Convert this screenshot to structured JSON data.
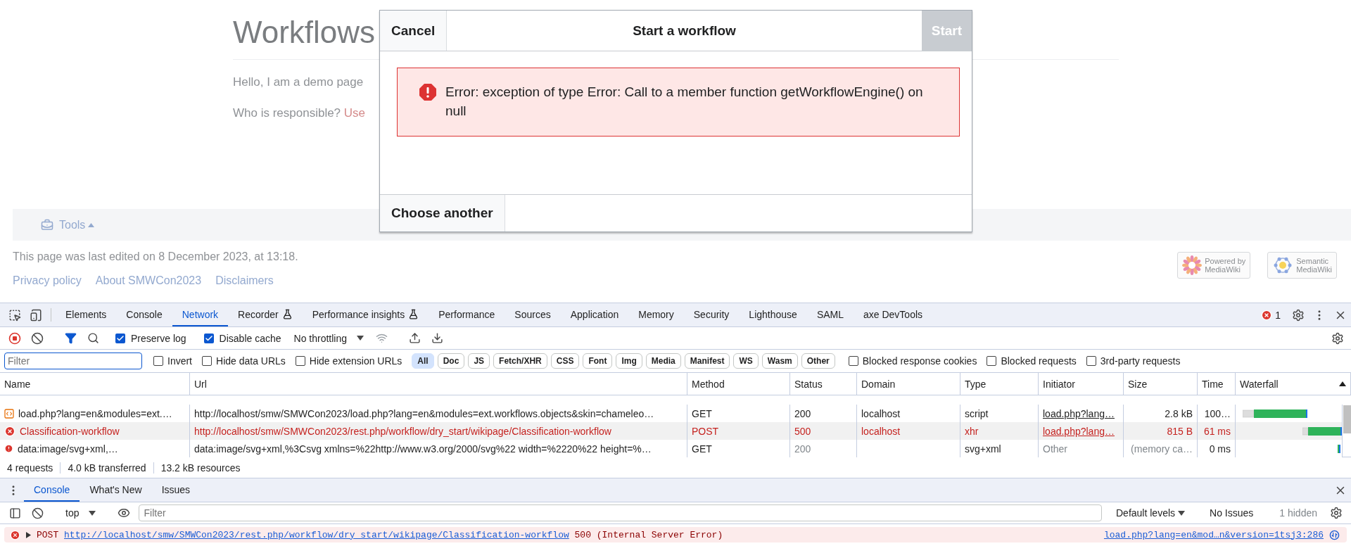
{
  "page": {
    "title": "Workflows",
    "intro": "Hello, I am a demo page",
    "responsible_label": "Who is responsible?",
    "responsible_link": "Use",
    "tools_label": "Tools",
    "last_edited": "This page was last edited on 8 December 2023, at 13:18.",
    "footer_links": [
      "Privacy policy",
      "About SMWCon2023",
      "Disclaimers"
    ],
    "badges": [
      {
        "line1": "Powered by",
        "line2": "MediaWiki",
        "kind": "flower"
      },
      {
        "line1": "Semantic",
        "line2": "MediaWiki",
        "kind": "network"
      }
    ]
  },
  "dialog": {
    "cancel": "Cancel",
    "title": "Start a workflow",
    "start": {
      "label": "Start",
      "disabled": true
    },
    "error": "Error: exception of type Error: Call to a member function getWorkflowEngine() on null",
    "choose": "Choose another"
  },
  "devtools": {
    "tabs": [
      {
        "label": "Elements",
        "selected": false,
        "experimental": false
      },
      {
        "label": "Console",
        "selected": false,
        "experimental": false
      },
      {
        "label": "Network",
        "selected": true,
        "experimental": false
      },
      {
        "label": "Recorder",
        "selected": false,
        "experimental": true
      },
      {
        "label": "Performance insights",
        "selected": false,
        "experimental": true
      },
      {
        "label": "Performance",
        "selected": false,
        "experimental": false
      },
      {
        "label": "Sources",
        "selected": false,
        "experimental": false
      },
      {
        "label": "Application",
        "selected": false,
        "experimental": false
      },
      {
        "label": "Memory",
        "selected": false,
        "experimental": false
      },
      {
        "label": "Security",
        "selected": false,
        "experimental": false
      },
      {
        "label": "Lighthouse",
        "selected": false,
        "experimental": false
      },
      {
        "label": "SAML",
        "selected": false,
        "experimental": false
      },
      {
        "label": "axe DevTools",
        "selected": false,
        "experimental": false
      }
    ],
    "error_count": "1",
    "toolbar": {
      "preserve_log": {
        "label": "Preserve log",
        "checked": true
      },
      "disable_cache": {
        "label": "Disable cache",
        "checked": true
      },
      "throttling": "No throttling"
    },
    "filter": {
      "placeholder": "Filter"
    },
    "filter_options": [
      {
        "label": "Invert",
        "checked": false
      },
      {
        "label": "Hide data URLs",
        "checked": false
      },
      {
        "label": "Hide extension URLs",
        "checked": false
      }
    ],
    "type_filters": [
      {
        "label": "All",
        "selected": true
      },
      {
        "label": "Doc",
        "selected": false
      },
      {
        "label": "JS",
        "selected": false
      },
      {
        "label": "Fetch/XHR",
        "selected": false
      },
      {
        "label": "CSS",
        "selected": false
      },
      {
        "label": "Font",
        "selected": false
      },
      {
        "label": "Img",
        "selected": false
      },
      {
        "label": "Media",
        "selected": false
      },
      {
        "label": "Manifest",
        "selected": false
      },
      {
        "label": "WS",
        "selected": false
      },
      {
        "label": "Wasm",
        "selected": false
      },
      {
        "label": "Other",
        "selected": false
      }
    ],
    "extra_filters": [
      {
        "label": "Blocked response cookies",
        "checked": false
      },
      {
        "label": "Blocked requests",
        "checked": false
      },
      {
        "label": "3rd-party requests",
        "checked": false
      }
    ],
    "table": {
      "columns": [
        {
          "label": "Name",
          "sorted": false
        },
        {
          "label": "Url",
          "sorted": false
        },
        {
          "label": "Method",
          "sorted": false
        },
        {
          "label": "Status",
          "sorted": false
        },
        {
          "label": "Domain",
          "sorted": false
        },
        {
          "label": "Type",
          "sorted": false
        },
        {
          "label": "Initiator",
          "sorted": false
        },
        {
          "label": "Size",
          "sorted": false
        },
        {
          "label": "Time",
          "sorted": false
        },
        {
          "label": "Waterfall",
          "sorted": true
        }
      ],
      "rows": [
        {
          "kind": "script",
          "failed": false,
          "selected": false,
          "cached": false,
          "name": "load.php?lang=en&modules=ext.…",
          "url": "http://localhost/smw/SMWCon2023/load.php?lang=en&modules=ext.workflows.objects&skin=chameleo…",
          "method": "GET",
          "status": "200",
          "domain": "localhost",
          "type": "script",
          "initiator": "load.php?lang…",
          "size": "2.8 kB",
          "time": "100…"
        },
        {
          "kind": "error",
          "failed": true,
          "selected": true,
          "cached": false,
          "name": "Classification-workflow",
          "url": "http://localhost/smw/SMWCon2023/rest.php/workflow/dry_start/wikipage/Classification-workflow",
          "method": "POST",
          "status": "500",
          "domain": "localhost",
          "type": "xhr",
          "initiator": "load.php?lang…",
          "size": "815 B",
          "time": "61 ms"
        },
        {
          "kind": "data",
          "failed": false,
          "selected": false,
          "cached": true,
          "name": "data:image/svg+xml,…",
          "url": "data:image/svg+xml,%3Csvg xmlns=%22http://www.w3.org/2000/svg%22 width=%2220%22 height=%…",
          "method": "GET",
          "status": "200",
          "type": "svg+xml",
          "initiator": "Other",
          "size": "(memory ca…",
          "time": "0 ms"
        }
      ]
    },
    "summary": [
      "4 requests",
      "4.0 kB transferred",
      "13.2 kB resources"
    ]
  },
  "drawer": {
    "tabs": [
      {
        "label": "Console",
        "selected": true
      },
      {
        "label": "What's New",
        "selected": false
      },
      {
        "label": "Issues",
        "selected": false
      }
    ],
    "context": "top",
    "filter": {
      "placeholder": "Filter"
    },
    "levels": "Default levels",
    "issues": "No Issues",
    "hidden": "1 hidden",
    "messages": [
      {
        "kind": "error",
        "method": "POST",
        "url": "http://localhost/smw/SMWCon2023/rest.php/workflow/dry_start/wikipage/Classification-workflow",
        "status": "500 (Internal Server Error)",
        "source": "load.php?lang=en&mod…n&version=1tsj3:286"
      }
    ]
  }
}
